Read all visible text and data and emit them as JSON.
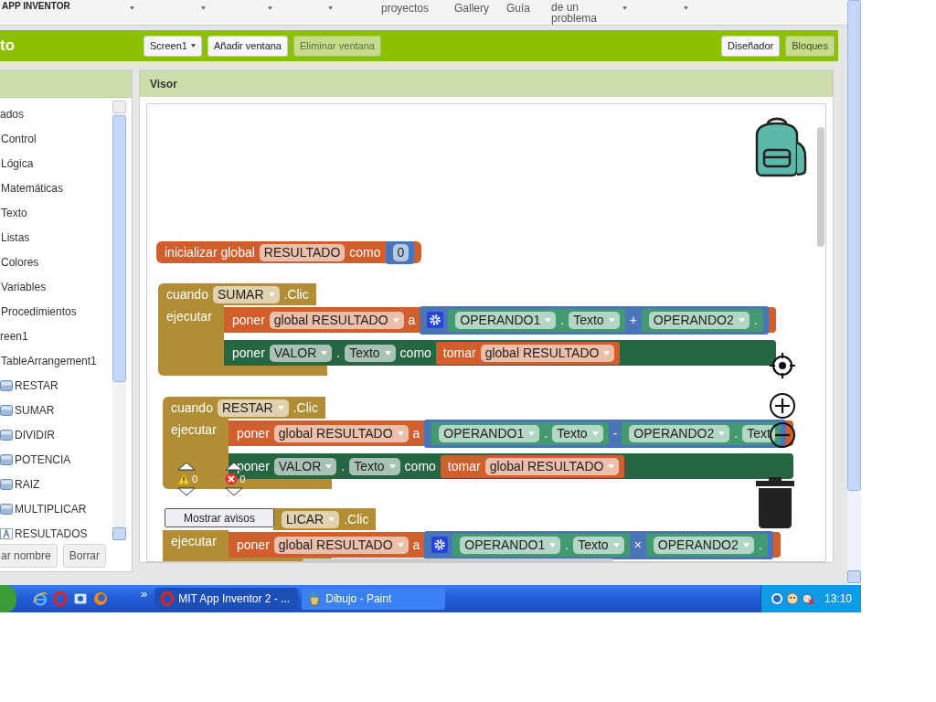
{
  "nav": {
    "brand": "APP INVENTOR",
    "menus": [
      {
        "caret": true
      },
      {
        "caret": true
      },
      {
        "caret": true
      },
      {
        "caret": true
      },
      {
        "lines": [
          "proyectos"
        ],
        "caret": false
      },
      {
        "lines": [
          "Gallery"
        ],
        "caret": false
      },
      {
        "lines": [
          "Guía"
        ],
        "caret": false
      },
      {
        "lines": [
          "de un",
          "problema"
        ],
        "caret": true
      },
      {
        "caret": true
      }
    ]
  },
  "toolbar": {
    "title": "to",
    "screen_dropdown": "Screen1",
    "buttons": [
      {
        "label": "Añadir ventana",
        "disabled": false
      },
      {
        "label": "Eliminar ventana",
        "disabled": true
      }
    ],
    "views": [
      {
        "label": "Diseñador",
        "selected": false
      },
      {
        "label": "Bloques",
        "selected": true
      }
    ]
  },
  "sidebar": {
    "items": [
      {
        "label": "ados",
        "children": [
          {
            "label": "Control"
          },
          {
            "label": "Lógica"
          },
          {
            "label": "Matemáticas"
          },
          {
            "label": "Texto"
          },
          {
            "label": "Listas"
          },
          {
            "label": "Colores"
          },
          {
            "label": "Variables"
          },
          {
            "label": "Procedimientos"
          }
        ]
      },
      {
        "label": "reen1",
        "children": [
          {
            "label": "TableArrangement1",
            "children": [
              {
                "label": "RESTAR",
                "kind": "button"
              },
              {
                "label": "SUMAR",
                "kind": "button"
              },
              {
                "label": "DIVIDIR",
                "kind": "button"
              },
              {
                "label": "POTENCIA",
                "kind": "button"
              },
              {
                "label": "RAIZ",
                "kind": "button"
              },
              {
                "label": "MULTIPLICAR",
                "kind": "button"
              },
              {
                "label": "RESULTADOS",
                "kind": "label"
              }
            ]
          }
        ]
      }
    ],
    "buttons": [
      "ar nombre",
      "Borrar"
    ]
  },
  "viewer": {
    "title": "Visor",
    "blocks": [
      {
        "kind": "global",
        "color": "#d05f2d",
        "pieces": [
          {
            "kind": "label",
            "text": "inicializar global"
          },
          {
            "kind": "field",
            "text": "RESULTADO"
          },
          {
            "kind": "label",
            "text": "como"
          },
          {
            "kind": "block",
            "color": "#4a75b9",
            "pieces": [
              {
                "kind": "number",
                "text": "0"
              }
            ]
          }
        ]
      },
      {
        "kind": "event",
        "color": "#b18e35",
        "header": [
          {
            "kind": "label",
            "text": "cuando"
          },
          {
            "kind": "dropdown",
            "text": "SUMAR"
          },
          {
            "kind": "label",
            "text": ".Clic"
          }
        ],
        "body_label": "ejecutar",
        "statements": [
          {
            "color": "#d05f2d",
            "pieces": [
              {
                "kind": "label",
                "text": "poner"
              },
              {
                "kind": "dropdown",
                "text": "global RESULTADO"
              },
              {
                "kind": "label",
                "text": "a"
              },
              {
                "kind": "block",
                "color": "#4a75b9",
                "pieces": [
                  {
                    "kind": "gear"
                  },
                  {
                    "kind": "block",
                    "color": "#439970",
                    "pieces": [
                      {
                        "kind": "dropdown",
                        "text": "OPERANDO1"
                      },
                      {
                        "kind": "label",
                        "text": "."
                      },
                      {
                        "kind": "dropdown",
                        "text": "Texto"
                      }
                    ]
                  },
                  {
                    "kind": "label",
                    "text": "+"
                  },
                  {
                    "kind": "block",
                    "color": "#439970",
                    "pieces": [
                      {
                        "kind": "dropdown",
                        "text": "OPERANDO2"
                      },
                      {
                        "kind": "label",
                        "text": "."
                      }
                    ]
                  }
                ]
              }
            ]
          },
          {
            "color": "#266643",
            "pieces": [
              {
                "kind": "label",
                "text": "poner"
              },
              {
                "kind": "dropdown",
                "text": "VALOR"
              },
              {
                "kind": "label",
                "text": "."
              },
              {
                "kind": "dropdown",
                "text": "Texto"
              },
              {
                "kind": "label",
                "text": "como"
              },
              {
                "kind": "block",
                "color": "#d05f2d",
                "pieces": [
                  {
                    "kind": "label",
                    "text": "tomar"
                  },
                  {
                    "kind": "dropdown",
                    "text": "global RESULTADO"
                  }
                ]
              }
            ]
          }
        ]
      },
      {
        "kind": "event",
        "color": "#b18e35",
        "header": [
          {
            "kind": "label",
            "text": "cuando"
          },
          {
            "kind": "dropdown",
            "text": "RESTAR"
          },
          {
            "kind": "label",
            "text": ".Clic"
          }
        ],
        "body_label": "ejecutar",
        "statements": [
          {
            "color": "#d05f2d",
            "pieces": [
              {
                "kind": "label",
                "text": "poner"
              },
              {
                "kind": "dropdown",
                "text": "global RESULTADO"
              },
              {
                "kind": "label",
                "text": "a"
              },
              {
                "kind": "block",
                "color": "#4a75b9",
                "pieces": [
                  {
                    "kind": "block",
                    "color": "#439970",
                    "pieces": [
                      {
                        "kind": "dropdown",
                        "text": "OPERANDO1"
                      },
                      {
                        "kind": "label",
                        "text": "."
                      },
                      {
                        "kind": "dropdown",
                        "text": "Texto"
                      }
                    ]
                  },
                  {
                    "kind": "label",
                    "text": "-"
                  },
                  {
                    "kind": "block",
                    "color": "#439970",
                    "pieces": [
                      {
                        "kind": "dropdown",
                        "text": "OPERANDO2"
                      },
                      {
                        "kind": "label",
                        "text": "."
                      },
                      {
                        "kind": "field",
                        "text": "Text"
                      }
                    ]
                  }
                ]
              }
            ]
          },
          {
            "color": "#266643",
            "pieces": [
              {
                "kind": "label",
                "text": "poner"
              },
              {
                "kind": "dropdown",
                "text": "VALOR"
              },
              {
                "kind": "label",
                "text": "."
              },
              {
                "kind": "dropdown",
                "text": "Texto"
              },
              {
                "kind": "label",
                "text": "como"
              },
              {
                "kind": "block",
                "color": "#d05f2d",
                "pieces": [
                  {
                    "kind": "label",
                    "text": "tomar"
                  },
                  {
                    "kind": "dropdown",
                    "text": "global RESULTADO"
                  }
                ]
              }
            ]
          }
        ]
      },
      {
        "kind": "event",
        "color": "#b18e35",
        "header": [
          {
            "kind": "dropdown",
            "text": "LICAR"
          },
          {
            "kind": "label",
            "text": ".Clic"
          }
        ],
        "body_label": "ejecutar",
        "statements": [
          {
            "color": "#d05f2d",
            "pieces": [
              {
                "kind": "label",
                "text": "poner"
              },
              {
                "kind": "dropdown",
                "text": "global RESULTADO"
              },
              {
                "kind": "label",
                "text": "a"
              },
              {
                "kind": "block",
                "color": "#4a75b9",
                "pieces": [
                  {
                    "kind": "gear"
                  },
                  {
                    "kind": "block",
                    "color": "#439970",
                    "pieces": [
                      {
                        "kind": "dropdown",
                        "text": "OPERANDO1"
                      },
                      {
                        "kind": "label",
                        "text": "."
                      },
                      {
                        "kind": "dropdown",
                        "text": "Texto"
                      }
                    ]
                  },
                  {
                    "kind": "label",
                    "text": "×"
                  },
                  {
                    "kind": "block",
                    "color": "#439970",
                    "pieces": [
                      {
                        "kind": "dropdown",
                        "text": "OPERANDO2"
                      },
                      {
                        "kind": "label",
                        "text": "."
                      }
                    ]
                  }
                ]
              }
            ]
          }
        ]
      }
    ],
    "warnings": {
      "warning_count": "0",
      "error_count": "0",
      "toggle_button": "Mostrar avisos"
    }
  },
  "taskbar": {
    "more": "»",
    "tasks": [
      {
        "label": "MIT App Inventor 2 - ...",
        "selected": true
      },
      {
        "label": "Dibujo - Paint",
        "selected": false
      }
    ],
    "clock": "13:10"
  }
}
